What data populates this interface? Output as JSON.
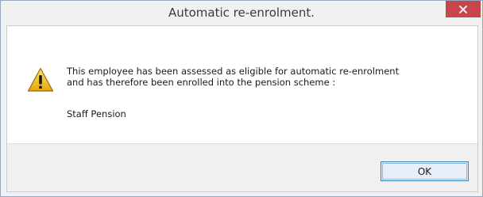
{
  "window": {
    "title": "Automatic re-enrolment."
  },
  "message": {
    "line1": "This employee has been assessed as eligible for automatic re-enrolment",
    "line2": "and has therefore been enrolled into the pension scheme :",
    "scheme_name": "Staff Pension"
  },
  "buttons": {
    "ok_label": "OK"
  },
  "icons": {
    "close": "close-icon",
    "warning": "warning-icon"
  },
  "colors": {
    "close_button": "#c7464b",
    "warning_fill": "#f2c318",
    "ok_border": "#3c7fb1"
  }
}
